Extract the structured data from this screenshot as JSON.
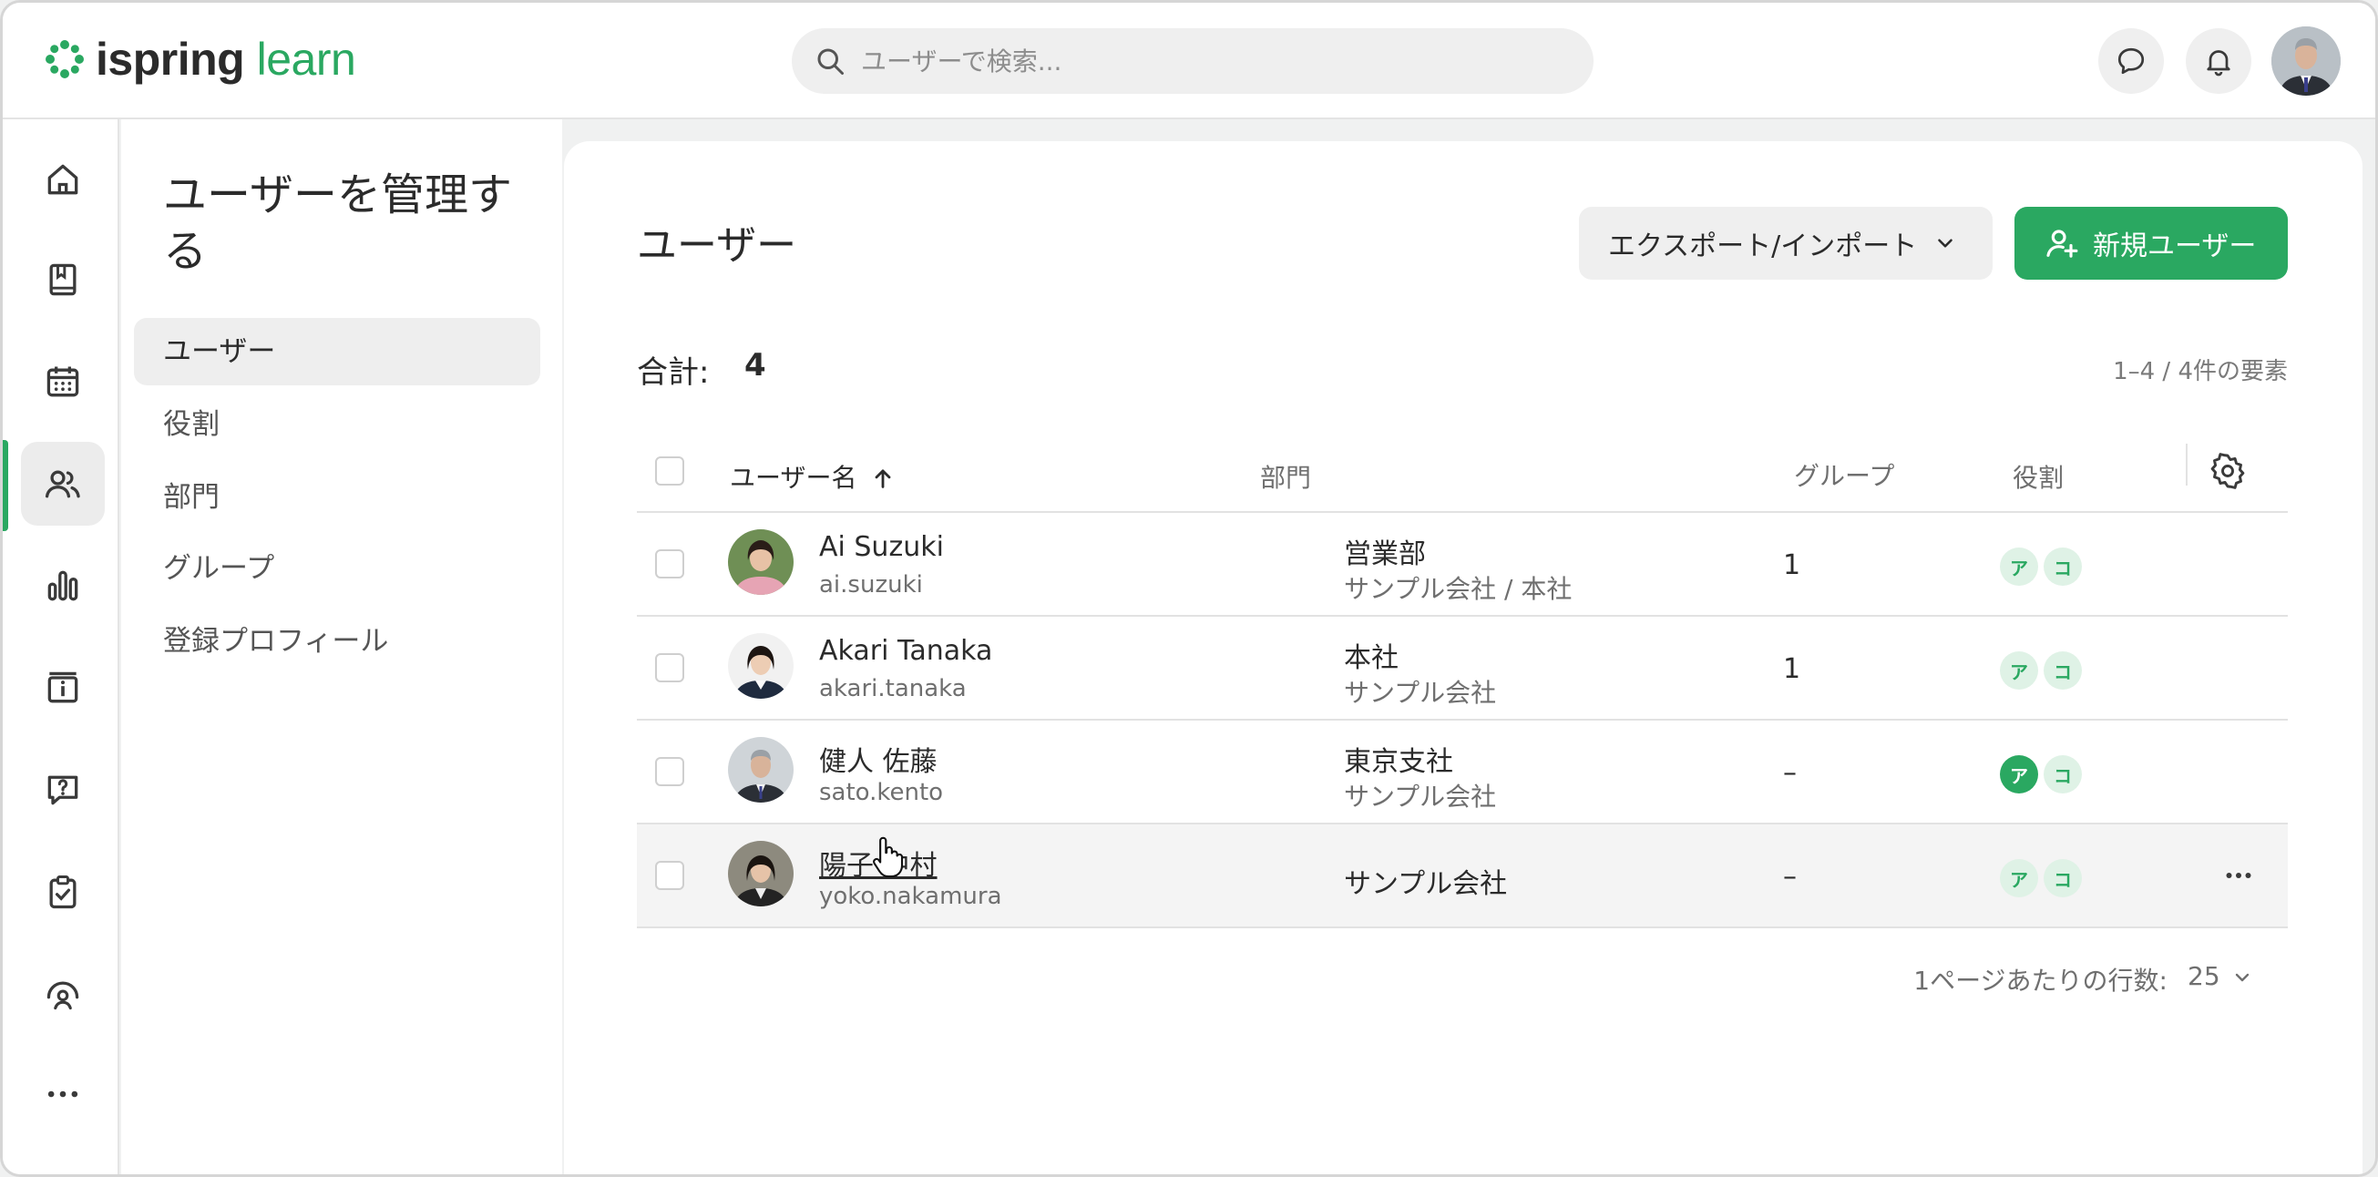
{
  "brand": {
    "name_bold": "ispring",
    "name_light": "learn",
    "color": "#2aa861"
  },
  "search": {
    "placeholder": "ユーザーで検索..."
  },
  "header_icons": [
    "chat-icon",
    "bell-icon",
    "user-avatar"
  ],
  "rail": {
    "items": [
      "home-icon",
      "book-icon",
      "calendar-icon",
      "users-icon",
      "reports-icon",
      "info-icon",
      "question-icon",
      "clipboard-check-icon",
      "gauge-user-icon",
      "more-icon"
    ],
    "active": "users-icon"
  },
  "subnav": {
    "title": "ユーザーを管理する",
    "items": [
      {
        "label": "ユーザー",
        "active": true
      },
      {
        "label": "役割"
      },
      {
        "label": "部門"
      },
      {
        "label": "グループ"
      },
      {
        "label": "登録プロフィール"
      }
    ]
  },
  "main": {
    "title": "ユーザー",
    "export_button": "エクスポート/インポート",
    "new_user_button": "新規ユーザー",
    "total_label": "合計:",
    "total_count": "4",
    "range_text": "1–4 / 4件の要素",
    "columns": {
      "name": "ユーザー名",
      "department": "部門",
      "group": "グループ",
      "role": "役割"
    },
    "rows": [
      {
        "name": "Ai Suzuki",
        "login": "ai.suzuki",
        "dept": "営業部",
        "dept_sub": "サンプル会社 / 本社",
        "group": "1",
        "roles": [
          "ア",
          "コ"
        ],
        "role_filled": false
      },
      {
        "name": "Akari Tanaka",
        "login": "akari.tanaka",
        "dept": "本社",
        "dept_sub": "サンプル会社",
        "group": "1",
        "roles": [
          "ア",
          "コ"
        ],
        "role_filled": false
      },
      {
        "name": "健人 佐藤",
        "login": "sato.kento",
        "dept": "東京支社",
        "dept_sub": "サンプル会社",
        "group": "–",
        "roles": [
          "ア",
          "コ"
        ],
        "role_filled": true
      },
      {
        "name": "陽子 中村",
        "login": "yoko.nakamura",
        "dept": "サンプル会社",
        "dept_sub": "",
        "group": "–",
        "roles": [
          "ア",
          "コ"
        ],
        "role_filled": false
      }
    ],
    "rows_per_page_label": "1ページあたりの行数:",
    "rows_per_page_value": "25"
  }
}
